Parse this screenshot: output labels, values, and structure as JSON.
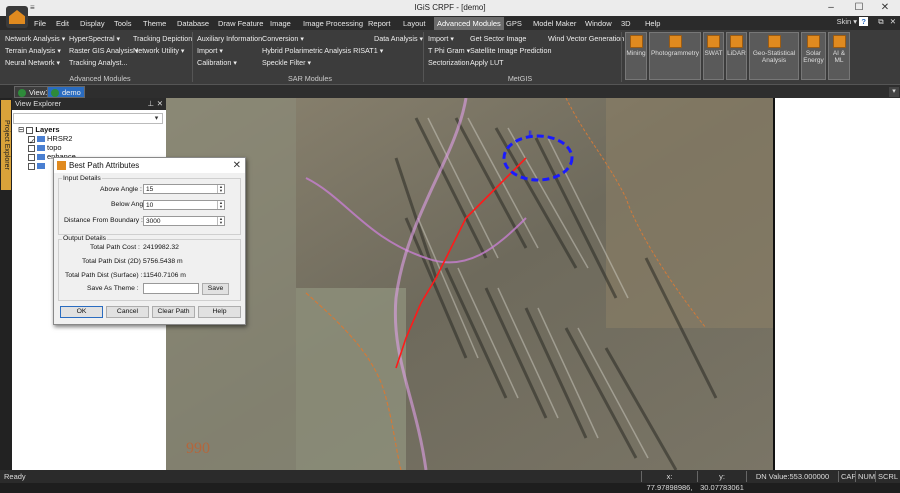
{
  "window": {
    "title": "IGiS CRPF - [demo]",
    "min": "–",
    "max": "☐",
    "close": "✕"
  },
  "quick_access": "≡",
  "menu": {
    "items": [
      "File",
      "Edit",
      "Display",
      "Tools",
      "Theme",
      "Database",
      "Draw Feature",
      "Image",
      "Image Processing",
      "Report",
      "Layout",
      "Advanced Modules",
      "GPS",
      "Model Maker",
      "Window",
      "3D",
      "Help"
    ],
    "active": "Advanced Modules",
    "skin": "Skin",
    "help_badge": "?"
  },
  "ribbon": {
    "advanced_modules": {
      "items": [
        "Network Analysis ▾",
        "Terrain Analysis ▾",
        "Neural Network ▾",
        "HyperSpectral ▾",
        "Raster GIS Analysis ▾",
        "Tracking Analyst...",
        "Tracking Depiction",
        "Network Utility ▾"
      ],
      "label": "Advanced Modules"
    },
    "sar_modules": {
      "items": [
        "Auxiliary Information",
        "Import ▾",
        "Calibration ▾",
        "Conversion ▾",
        "Hybrid Polarimetric Analysis RISAT1 ▾",
        "Speckle Filter ▾",
        "Data Analysis ▾"
      ],
      "label": "SAR Modules"
    },
    "metgis": {
      "items": [
        "Import ▾",
        "T Phi Gram ▾",
        "Sectorization",
        "Get Sector Image",
        "Satellite Image Prediction",
        "Apply LUT",
        "Wind Vector Generation"
      ],
      "label": "MetGIS"
    },
    "big_buttons": [
      "Mining",
      "Photogrammetry",
      "SWAT",
      "LiDAR",
      "Geo-Statistical Analysis",
      "Solar Energy",
      "AI & ML"
    ]
  },
  "tabs": {
    "view1": "View1",
    "demo": "demo",
    "dropdown": "▾"
  },
  "left_strip": {
    "label": "Project Explorer"
  },
  "view_explorer": {
    "title": "View Explorer",
    "pin": "📌",
    "close": "✕",
    "dropdown": "▾",
    "root": "Layers",
    "layers": [
      "HRSR2",
      "topo",
      "enhance",
      ""
    ]
  },
  "dialog": {
    "title": "Best Path Attributes",
    "close": "✕",
    "input_details": "Input Details",
    "above_angle_label": "Above Angle :",
    "above_angle": "15",
    "below_angle_label": "Below Angle :",
    "below_angle": "10",
    "distance_label": "Distance From Boundary :",
    "distance": "3000",
    "output_details": "Output Details",
    "cost_label": "Total Path Cost :",
    "cost": "2419982.32",
    "dist2d_label": "Total Path Dist (2D) :",
    "dist2d": "5756.5438 m",
    "distsurf_label": "Total Path Dist (Surface) :",
    "distsurf": "11540.7106 m",
    "save_theme_label": "Save As Theme :",
    "save_theme_value": "",
    "save_btn": "Save",
    "ok": "OK",
    "cancel": "Cancel",
    "clear_path": "Clear Path",
    "help": "Help"
  },
  "map": {
    "label_text": "990"
  },
  "status": {
    "ready": "Ready",
    "x": "x: 77.97898986,",
    "y": "y: 30.07783061",
    "dn": "DN Value:553.000000",
    "cap": "CAP",
    "num": "NUM",
    "scrl": "SCRL"
  },
  "colors": {
    "accent": "#e08a1f",
    "path": "#ff1a1a",
    "boundary": "#1a1aff",
    "tab_selected": "#2a6cc0"
  }
}
